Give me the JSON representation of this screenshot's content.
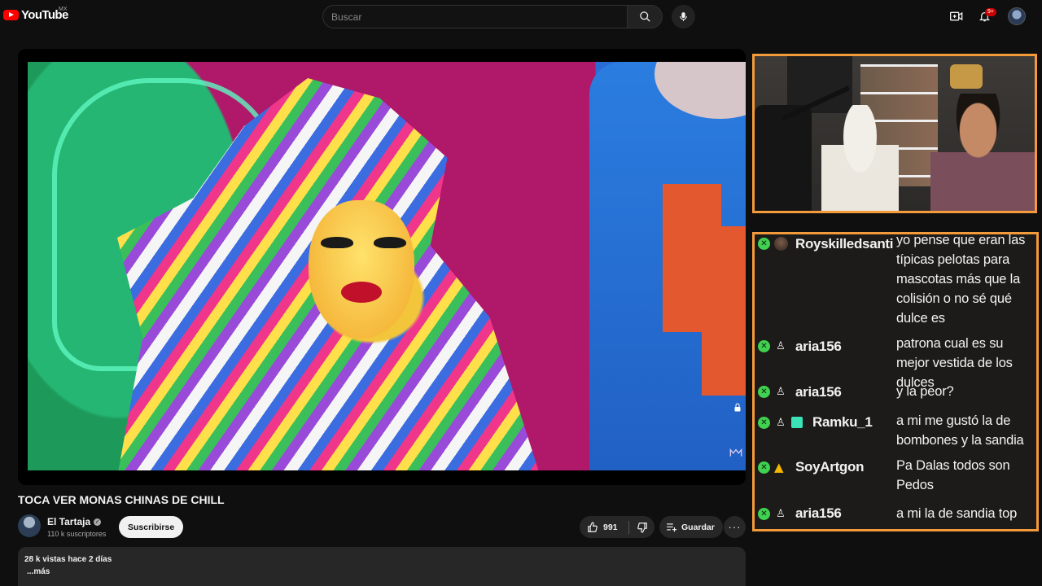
{
  "header": {
    "logo_text": "YouTube",
    "country_code": "MX",
    "search_placeholder": "Buscar",
    "notifications_count": "9+"
  },
  "video": {
    "title": "TOCA VER MONAS CHINAS DE CHILL",
    "channel": {
      "name": "El Tartaja",
      "subscribers": "110 k suscriptores",
      "subscribe_label": "Suscribirse"
    },
    "likes": "991",
    "save_label": "Guardar",
    "more_label": "···",
    "description": {
      "meta": "28 k vistas  hace 2 días",
      "more": "...más"
    }
  },
  "chat": {
    "messages": [
      {
        "user": "Royskilledsanti",
        "badges": [
          "x-badge",
          "avatar-badge"
        ],
        "text": "yo pense que eran las típicas pelotas para mascotas más que la colisión o no sé qué dulce es"
      },
      {
        "user": "aria156",
        "badges": [
          "x-badge",
          "user-badge"
        ],
        "text": "patrona cual es su mejor vestida de los dulces"
      },
      {
        "user": "aria156",
        "badges": [
          "x-badge",
          "user-badge"
        ],
        "text": "y la peor?"
      },
      {
        "user": "Ramku_1",
        "badges": [
          "x-badge",
          "user-badge",
          "gift-badge"
        ],
        "text": "a mi me gustó la de bombones y la sandia"
      },
      {
        "user": "SoyArtgon",
        "badges": [
          "x-badge",
          "gold-badge"
        ],
        "text": "Pa Dalas todos son Pedos"
      },
      {
        "user": "aria156",
        "badges": [
          "x-badge",
          "user-badge"
        ],
        "text": "a mi la de sandia top"
      }
    ]
  },
  "colors": {
    "accent_red": "#ff0000",
    "overlay_border": "#f39a3a",
    "chat_badge_green": "#3fd14f"
  }
}
